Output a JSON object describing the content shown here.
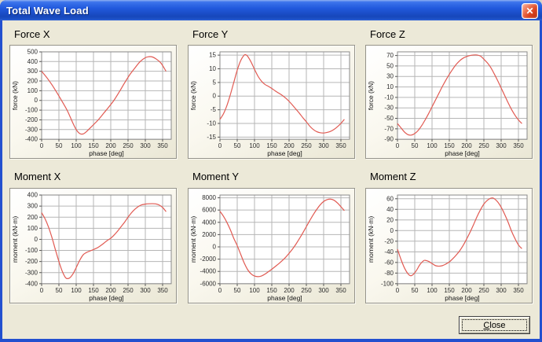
{
  "window": {
    "title": "Total Wave Load",
    "close_glyph": "✕"
  },
  "button": {
    "close_label": "Close"
  },
  "colors": {
    "titlebar_blue": "#1e51d6",
    "frame_blue": "#2350cf",
    "client_bg": "#ece9d8",
    "curve_red": "#e15a52",
    "grid_gray": "#b6b6b6",
    "plot_frame_gray": "#8a8a8a",
    "close_x_red": "#d8401c"
  },
  "chart_data": [
    {
      "type": "line",
      "name": "force-x",
      "title": "Force X",
      "xlabel": "phase [deg]",
      "ylabel": "force (kN)",
      "xticks": [
        0,
        50,
        100,
        150,
        200,
        250,
        300,
        350
      ],
      "yticks": [
        500,
        400,
        300,
        200,
        100,
        0,
        -100,
        -200,
        -300,
        -400
      ],
      "xlim": [
        0,
        375
      ],
      "ylim": [
        -400,
        500
      ],
      "grid": true,
      "points": [
        [
          0,
          300
        ],
        [
          15,
          235
        ],
        [
          30,
          160
        ],
        [
          45,
          75
        ],
        [
          60,
          -15
        ],
        [
          75,
          -110
        ],
        [
          90,
          -230
        ],
        [
          100,
          -300
        ],
        [
          110,
          -340
        ],
        [
          120,
          -345
        ],
        [
          130,
          -320
        ],
        [
          140,
          -285
        ],
        [
          150,
          -250
        ],
        [
          165,
          -195
        ],
        [
          180,
          -130
        ],
        [
          195,
          -65
        ],
        [
          210,
          5
        ],
        [
          225,
          90
        ],
        [
          240,
          180
        ],
        [
          255,
          265
        ],
        [
          270,
          335
        ],
        [
          285,
          400
        ],
        [
          300,
          440
        ],
        [
          310,
          450
        ],
        [
          320,
          448
        ],
        [
          330,
          430
        ],
        [
          345,
          385
        ],
        [
          360,
          300
        ]
      ]
    },
    {
      "type": "line",
      "name": "force-y",
      "title": "Force Y",
      "xlabel": "phase [deg]",
      "ylabel": "force (kN)",
      "xticks": [
        0,
        50,
        100,
        150,
        200,
        250,
        300,
        350
      ],
      "yticks": [
        15,
        10,
        5,
        0,
        -5,
        -10,
        -15
      ],
      "xlim": [
        0,
        375
      ],
      "ylim": [
        -15.8,
        16.2
      ],
      "grid": true,
      "points": [
        [
          0,
          -8.5
        ],
        [
          10,
          -6.5
        ],
        [
          20,
          -3.5
        ],
        [
          30,
          0.5
        ],
        [
          40,
          5
        ],
        [
          50,
          9.5
        ],
        [
          60,
          13
        ],
        [
          70,
          15
        ],
        [
          75,
          15.1
        ],
        [
          80,
          14.6
        ],
        [
          90,
          12.5
        ],
        [
          100,
          9.8
        ],
        [
          110,
          7.3
        ],
        [
          120,
          5.5
        ],
        [
          130,
          4.3
        ],
        [
          140,
          3.6
        ],
        [
          150,
          2.8
        ],
        [
          160,
          1.9
        ],
        [
          170,
          1.1
        ],
        [
          180,
          0.3
        ],
        [
          190,
          -0.7
        ],
        [
          200,
          -1.9
        ],
        [
          210,
          -3.3
        ],
        [
          220,
          -4.8
        ],
        [
          230,
          -6.3
        ],
        [
          240,
          -7.9
        ],
        [
          250,
          -9.4
        ],
        [
          260,
          -11
        ],
        [
          270,
          -12.2
        ],
        [
          280,
          -13
        ],
        [
          290,
          -13.4
        ],
        [
          300,
          -13.5
        ],
        [
          310,
          -13.3
        ],
        [
          320,
          -12.9
        ],
        [
          330,
          -12.2
        ],
        [
          340,
          -11.2
        ],
        [
          350,
          -10
        ],
        [
          360,
          -8.5
        ]
      ]
    },
    {
      "type": "line",
      "name": "force-z",
      "title": "Force Z",
      "xlabel": "phase [deg]",
      "ylabel": "force (kN)",
      "xticks": [
        0,
        50,
        100,
        150,
        200,
        250,
        300,
        350
      ],
      "yticks": [
        70,
        50,
        30,
        10,
        -10,
        -30,
        -50,
        -70,
        -90
      ],
      "xlim": [
        0,
        375
      ],
      "ylim": [
        -90,
        77
      ],
      "grid": true,
      "points": [
        [
          0,
          -60
        ],
        [
          10,
          -68
        ],
        [
          20,
          -76
        ],
        [
          30,
          -81
        ],
        [
          40,
          -82
        ],
        [
          50,
          -79
        ],
        [
          60,
          -73
        ],
        [
          70,
          -64
        ],
        [
          80,
          -53
        ],
        [
          90,
          -41
        ],
        [
          100,
          -28
        ],
        [
          110,
          -15
        ],
        [
          120,
          -2
        ],
        [
          130,
          11
        ],
        [
          140,
          23
        ],
        [
          150,
          34
        ],
        [
          160,
          44
        ],
        [
          170,
          53
        ],
        [
          180,
          60
        ],
        [
          190,
          65
        ],
        [
          200,
          68
        ],
        [
          210,
          70
        ],
        [
          220,
          71
        ],
        [
          230,
          71
        ],
        [
          240,
          69
        ],
        [
          250,
          63
        ],
        [
          260,
          56
        ],
        [
          270,
          47
        ],
        [
          280,
          35
        ],
        [
          290,
          22
        ],
        [
          300,
          8
        ],
        [
          310,
          -6
        ],
        [
          320,
          -20
        ],
        [
          330,
          -33
        ],
        [
          340,
          -44
        ],
        [
          350,
          -53
        ],
        [
          360,
          -60
        ]
      ]
    },
    {
      "type": "line",
      "name": "moment-x",
      "title": "Moment X",
      "xlabel": "phase [deg]",
      "ylabel": "moment (kN·m)",
      "xticks": [
        0,
        50,
        100,
        150,
        200,
        250,
        300,
        350
      ],
      "yticks": [
        400,
        300,
        200,
        100,
        0,
        -100,
        -200,
        -300,
        -400
      ],
      "xlim": [
        0,
        375
      ],
      "ylim": [
        -400,
        400
      ],
      "grid": true,
      "points": [
        [
          0,
          240
        ],
        [
          10,
          185
        ],
        [
          20,
          110
        ],
        [
          30,
          15
        ],
        [
          40,
          -95
        ],
        [
          50,
          -200
        ],
        [
          60,
          -290
        ],
        [
          70,
          -348
        ],
        [
          80,
          -350
        ],
        [
          90,
          -315
        ],
        [
          100,
          -255
        ],
        [
          110,
          -190
        ],
        [
          120,
          -140
        ],
        [
          130,
          -118
        ],
        [
          140,
          -105
        ],
        [
          150,
          -92
        ],
        [
          160,
          -78
        ],
        [
          170,
          -58
        ],
        [
          180,
          -35
        ],
        [
          190,
          -10
        ],
        [
          200,
          10
        ],
        [
          210,
          40
        ],
        [
          220,
          75
        ],
        [
          230,
          115
        ],
        [
          240,
          155
        ],
        [
          250,
          200
        ],
        [
          260,
          240
        ],
        [
          270,
          272
        ],
        [
          280,
          297
        ],
        [
          290,
          312
        ],
        [
          300,
          318
        ],
        [
          310,
          321
        ],
        [
          320,
          322
        ],
        [
          330,
          320
        ],
        [
          340,
          310
        ],
        [
          350,
          288
        ],
        [
          360,
          250
        ]
      ]
    },
    {
      "type": "line",
      "name": "moment-y",
      "title": "Moment Y",
      "xlabel": "phase [deg]",
      "ylabel": "moment (kN·m)",
      "xticks": [
        0,
        50,
        100,
        150,
        200,
        250,
        300,
        350
      ],
      "yticks": [
        8000,
        6000,
        4000,
        2000,
        0,
        -2000,
        -4000,
        -6000
      ],
      "xlim": [
        0,
        375
      ],
      "ylim": [
        -6000,
        8450
      ],
      "grid": true,
      "points": [
        [
          0,
          5800
        ],
        [
          10,
          5000
        ],
        [
          20,
          4000
        ],
        [
          30,
          2800
        ],
        [
          40,
          1400
        ],
        [
          50,
          200
        ],
        [
          60,
          -1200
        ],
        [
          70,
          -2600
        ],
        [
          80,
          -3700
        ],
        [
          90,
          -4400
        ],
        [
          100,
          -4750
        ],
        [
          110,
          -4850
        ],
        [
          120,
          -4750
        ],
        [
          130,
          -4450
        ],
        [
          140,
          -4050
        ],
        [
          150,
          -3650
        ],
        [
          160,
          -3200
        ],
        [
          170,
          -2750
        ],
        [
          180,
          -2250
        ],
        [
          190,
          -1700
        ],
        [
          200,
          -1050
        ],
        [
          210,
          -350
        ],
        [
          220,
          450
        ],
        [
          230,
          1350
        ],
        [
          240,
          2300
        ],
        [
          250,
          3300
        ],
        [
          260,
          4300
        ],
        [
          270,
          5250
        ],
        [
          280,
          6100
        ],
        [
          290,
          6850
        ],
        [
          300,
          7400
        ],
        [
          310,
          7700
        ],
        [
          320,
          7780
        ],
        [
          330,
          7600
        ],
        [
          340,
          7150
        ],
        [
          350,
          6550
        ],
        [
          360,
          5900
        ]
      ]
    },
    {
      "type": "line",
      "name": "moment-z",
      "title": "Moment Z",
      "xlabel": "phase [deg]",
      "ylabel": "moment (kN·m)",
      "xticks": [
        0,
        50,
        100,
        150,
        200,
        250,
        300,
        350
      ],
      "yticks": [
        60,
        40,
        20,
        0,
        -20,
        -40,
        -60,
        -80,
        -100
      ],
      "xlim": [
        0,
        375
      ],
      "ylim": [
        -100,
        67
      ],
      "grid": true,
      "points": [
        [
          0,
          -35
        ],
        [
          10,
          -54
        ],
        [
          20,
          -70
        ],
        [
          30,
          -81
        ],
        [
          38,
          -85
        ],
        [
          45,
          -83
        ],
        [
          55,
          -75
        ],
        [
          65,
          -64
        ],
        [
          75,
          -57
        ],
        [
          80,
          -56
        ],
        [
          90,
          -58
        ],
        [
          100,
          -62
        ],
        [
          110,
          -66
        ],
        [
          120,
          -67
        ],
        [
          130,
          -66
        ],
        [
          140,
          -63
        ],
        [
          150,
          -59
        ],
        [
          160,
          -53
        ],
        [
          170,
          -46
        ],
        [
          180,
          -38
        ],
        [
          190,
          -28
        ],
        [
          200,
          -16
        ],
        [
          210,
          -3
        ],
        [
          220,
          11
        ],
        [
          230,
          26
        ],
        [
          240,
          39
        ],
        [
          250,
          50
        ],
        [
          260,
          57
        ],
        [
          270,
          61
        ],
        [
          278,
          61
        ],
        [
          290,
          54
        ],
        [
          300,
          44
        ],
        [
          310,
          31
        ],
        [
          320,
          16
        ],
        [
          330,
          -1
        ],
        [
          340,
          -15
        ],
        [
          350,
          -27
        ],
        [
          360,
          -34
        ]
      ]
    }
  ]
}
